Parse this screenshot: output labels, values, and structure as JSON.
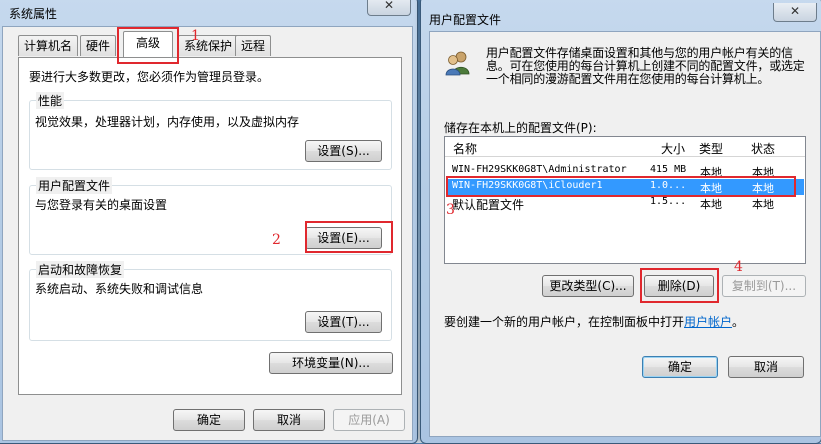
{
  "left_window": {
    "title": "系统属性",
    "close_label": "✕",
    "tabs": [
      "计算机名",
      "硬件",
      "高级",
      "系统保护",
      "远程"
    ],
    "admin_note": "要进行大多数更改，您必须作为管理员登录。",
    "performance": {
      "title": "性能",
      "desc": "视觉效果，处理器计划，内存使用，以及虚拟内存",
      "button": "设置(S)..."
    },
    "user_profiles": {
      "title": "用户配置文件",
      "desc": "与您登录有关的桌面设置",
      "button": "设置(E)..."
    },
    "startup": {
      "title": "启动和故障恢复",
      "desc": "系统启动、系统失败和调试信息",
      "button": "设置(T)..."
    },
    "env_button": "环境变量(N)...",
    "ok": "确定",
    "cancel": "取消",
    "apply": "应用(A)"
  },
  "right_window": {
    "title": "用户配置文件",
    "close_label": "✕",
    "intro": "用户配置文件存储桌面设置和其他与您的用户帐户有关的信息。可在您使用的每台计算机上创建不同的配置文件，或选定一个相同的漫游配置文件用在您使用的每台计算机上。",
    "list_label": "储存在本机上的配置文件(P):",
    "columns": [
      "名称",
      "大小",
      "类型",
      "状态"
    ],
    "rows": [
      {
        "name": "WIN-FH29SKK0G8T\\Administrator",
        "size": "415 MB",
        "type": "本地",
        "status": "本地"
      },
      {
        "name": "WIN-FH29SKK0G8T\\iClouder1",
        "size": "1.0...",
        "type": "本地",
        "status": "本地"
      },
      {
        "name": "默认配置文件",
        "size": "1.5...",
        "type": "本地",
        "status": "本地"
      }
    ],
    "change_type_button": "更改类型(C)...",
    "delete_button": "删除(D)",
    "copy_button": "复制到(T)...",
    "create_note": "要创建一个新的用户帐户，在控制面板中打开",
    "create_link": "用户帐户",
    "create_note_end": "。",
    "ok": "确定",
    "cancel": "取消"
  },
  "annotations": [
    "1",
    "2",
    "3",
    "4"
  ]
}
